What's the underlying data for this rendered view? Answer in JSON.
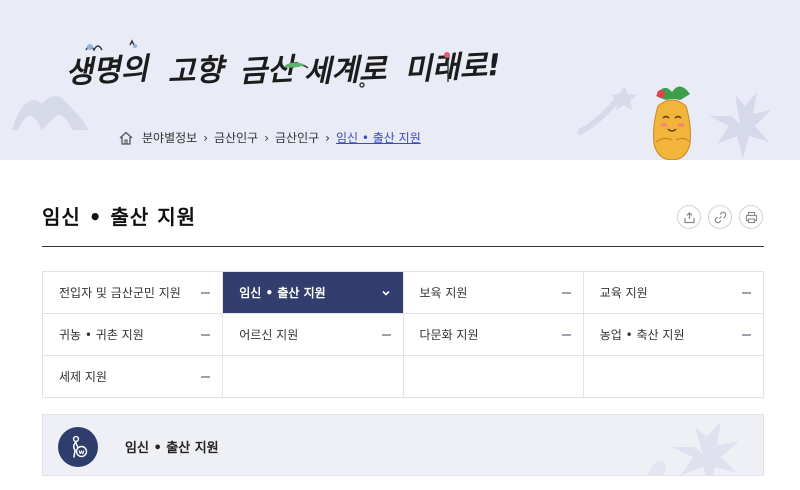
{
  "banner": {
    "slogan": "생명의 고향, 금산 세계로 미래로!",
    "colors": {
      "background": "#e9ebf6",
      "accent": "#3b4fb8"
    }
  },
  "breadcrumb": {
    "items": [
      "분야별정보",
      "금산인구",
      "금산인구"
    ],
    "current": "임신 • 출산 지원"
  },
  "page": {
    "title": "임신 • 출산 지원"
  },
  "tools": {
    "share_icon": "share-icon",
    "link_icon": "link-icon",
    "print_icon": "print-icon"
  },
  "menu": {
    "items": [
      {
        "label": "전입자 및 금산군민 지원",
        "active": false
      },
      {
        "label": "임신 • 출산 지원",
        "active": true
      },
      {
        "label": "보육 지원",
        "active": false
      },
      {
        "label": "교육 지원",
        "active": false
      },
      {
        "label": "귀농 • 귀촌 지원",
        "active": false
      },
      {
        "label": "어르신 지원",
        "active": false
      },
      {
        "label": "다문화 지원",
        "active": false
      },
      {
        "label": "농업 • 축산 지원",
        "active": false
      },
      {
        "label": "세제 지원",
        "active": false
      }
    ],
    "active_color": "#313e6e"
  },
  "section": {
    "title": "임신 • 출산 지원",
    "icon": "pregnant-woman-icon"
  }
}
